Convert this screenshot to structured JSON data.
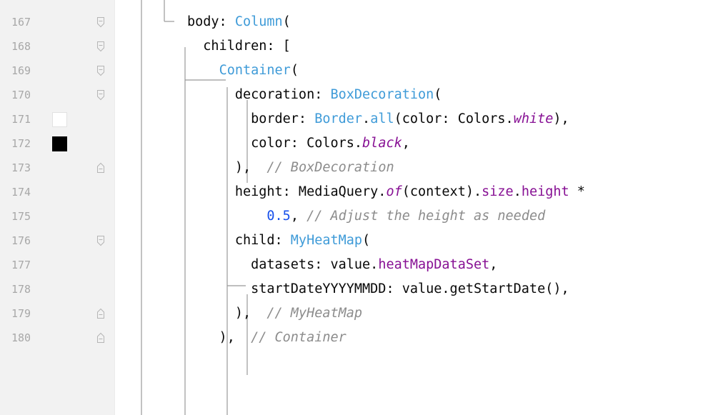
{
  "editor": {
    "lines": [
      {
        "num": "167",
        "segments": [
          {
            "t": "body: ",
            "c": ""
          },
          {
            "t": "Column",
            "c": "k-cls"
          },
          {
            "t": "(",
            "c": ""
          }
        ]
      },
      {
        "num": "168",
        "segments": [
          {
            "t": "  children: [",
            "c": ""
          }
        ]
      },
      {
        "num": "169",
        "segments": [
          {
            "t": "    ",
            "c": ""
          },
          {
            "t": "Container",
            "c": "k-cls"
          },
          {
            "t": "(",
            "c": ""
          }
        ]
      },
      {
        "num": "170",
        "segments": [
          {
            "t": "      decoration: ",
            "c": ""
          },
          {
            "t": "BoxDecoration",
            "c": "k-cls"
          },
          {
            "t": "(",
            "c": ""
          }
        ]
      },
      {
        "num": "171",
        "segments": [
          {
            "t": "        border: ",
            "c": ""
          },
          {
            "t": "Border",
            "c": "k-cls"
          },
          {
            "t": ".",
            "c": ""
          },
          {
            "t": "all",
            "c": "k-cls"
          },
          {
            "t": "(color: Colors.",
            "c": ""
          },
          {
            "t": "white",
            "c": "k-it"
          },
          {
            "t": "),",
            "c": ""
          }
        ]
      },
      {
        "num": "172",
        "segments": [
          {
            "t": "        color: Colors.",
            "c": ""
          },
          {
            "t": "black",
            "c": "k-it"
          },
          {
            "t": ",",
            "c": ""
          }
        ]
      },
      {
        "num": "173",
        "segments": [
          {
            "t": "      ),  ",
            "c": ""
          },
          {
            "t": "// BoxDecoration",
            "c": "k-cmt"
          }
        ]
      },
      {
        "num": "174",
        "segments": [
          {
            "t": "      height: MediaQuery.",
            "c": ""
          },
          {
            "t": "of",
            "c": "k-it"
          },
          {
            "t": "(context).",
            "c": ""
          },
          {
            "t": "size",
            "c": "k-prop"
          },
          {
            "t": ".",
            "c": ""
          },
          {
            "t": "height",
            "c": "k-prop"
          },
          {
            "t": " *",
            "c": ""
          }
        ]
      },
      {
        "num": "175",
        "segments": [
          {
            "t": "          ",
            "c": ""
          },
          {
            "t": "0.5",
            "c": "k-num"
          },
          {
            "t": ", ",
            "c": ""
          },
          {
            "t": "// Adjust the height as needed",
            "c": "k-cmt"
          }
        ]
      },
      {
        "num": "176",
        "segments": [
          {
            "t": "      child: ",
            "c": ""
          },
          {
            "t": "MyHeatMap",
            "c": "k-cls"
          },
          {
            "t": "(",
            "c": ""
          }
        ]
      },
      {
        "num": "177",
        "segments": [
          {
            "t": "        datasets: value.",
            "c": ""
          },
          {
            "t": "heatMapDataSet",
            "c": "k-prop"
          },
          {
            "t": ",",
            "c": ""
          }
        ]
      },
      {
        "num": "178",
        "segments": [
          {
            "t": "        startDateYYYYMMDD: value.getStartDate(),",
            "c": ""
          }
        ]
      },
      {
        "num": "179",
        "segments": [
          {
            "t": "      ),  ",
            "c": ""
          },
          {
            "t": "// MyHeatMap",
            "c": "k-cmt"
          }
        ]
      },
      {
        "num": "180",
        "segments": [
          {
            "t": "    ),  ",
            "c": ""
          },
          {
            "t": "// Container",
            "c": "k-cmt"
          }
        ]
      }
    ],
    "color_swatches": {
      "171": "#ffffff",
      "172": "#000000"
    },
    "fold_markers": {
      "167": "fold-open",
      "168": "fold-open",
      "169": "fold-open",
      "170": "fold-open",
      "173": "fold-close",
      "176": "fold-open",
      "179": "fold-close",
      "180": "fold-close"
    }
  }
}
